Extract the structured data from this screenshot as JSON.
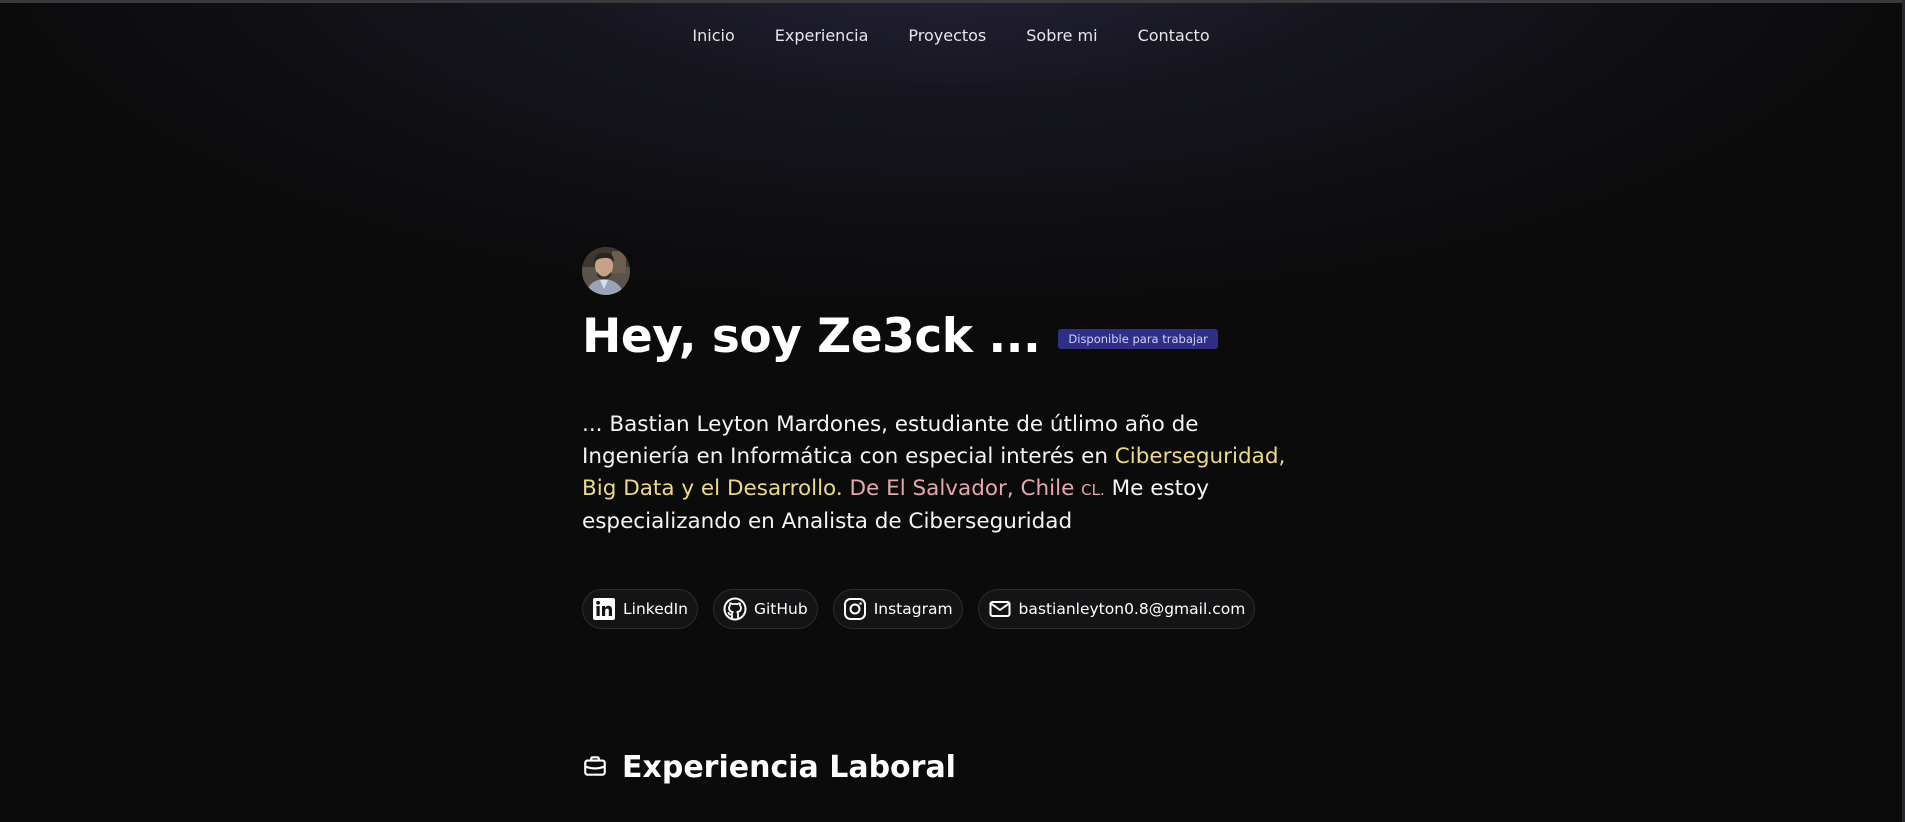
{
  "nav": {
    "items": [
      {
        "label": "Inicio"
      },
      {
        "label": "Experiencia"
      },
      {
        "label": "Proyectos"
      },
      {
        "label": "Sobre mi"
      },
      {
        "label": "Contacto"
      }
    ]
  },
  "hero": {
    "title": "Hey, soy Ze3ck ...",
    "badge": "Disponible para trabajar",
    "description": {
      "intro": "... Bastian Leyton Mardones, estudiante de útlimo año de Ingeniería en Informática con especial interés en ",
      "interests": "Ciberseguridad, Big Data y el Desarrollo.",
      "location": " De El Salvador, Chile ",
      "country_code": "CL.",
      "outro": " Me estoy especializando en Analista de Ciberseguridad"
    }
  },
  "socials": [
    {
      "label": "LinkedIn",
      "icon": "linkedin-icon"
    },
    {
      "label": "GitHub",
      "icon": "github-icon"
    },
    {
      "label": "Instagram",
      "icon": "instagram-icon"
    },
    {
      "label": "bastianleyton0.8@gmail.com",
      "icon": "mail-icon"
    }
  ],
  "section": {
    "title": "Experiencia Laboral",
    "icon": "briefcase-icon"
  },
  "colors": {
    "background": "#0b0b0c",
    "badge_bg": "#2f2f86",
    "highlight_yellow": "#ecd98a",
    "highlight_pink": "#e6a7ad"
  }
}
